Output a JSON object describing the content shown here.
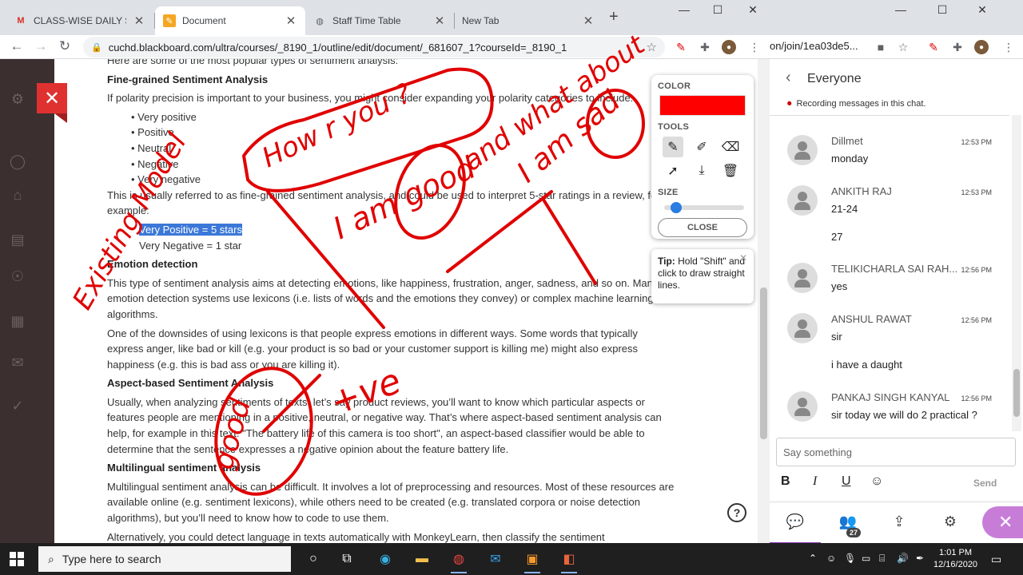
{
  "browser_left": {
    "tabs": [
      {
        "label": "CLASS-WISE DAILY STUD",
        "icon": "gmail-icon",
        "close": "✕"
      },
      {
        "label": "Document",
        "icon": "blackboard-icon",
        "close": "✕"
      },
      {
        "label": "Staff Time Table",
        "icon": "globe-icon",
        "close": "✕"
      },
      {
        "label": "New Tab",
        "icon": "",
        "close": "✕"
      }
    ],
    "new_tab": "+",
    "window_controls": {
      "minimize": "—",
      "maximize": "☐",
      "close": "✕"
    },
    "url": "cuchd.blackboard.com/ultra/courses/_8190_1/outline/edit/document/_681607_1?courseId=_8190_1"
  },
  "document": {
    "intro": "Here are some of the most popular types of sentiment analysis:",
    "sections": {
      "fine_grained": {
        "heading": "Fine-grained Sentiment Analysis",
        "p1": "If polarity precision is important to your business, you might consider expanding your polarity categories to include:",
        "bullets": [
          "Very positive",
          "Positive",
          "Neutral",
          "Negative",
          "Very negative"
        ],
        "p2": "This is usually referred to as fine-grained sentiment analysis, and could be used to interpret 5-star ratings in a review, for example:",
        "ex1": "Very Positive = 5 stars",
        "ex2": "Very Negative = 1 star"
      },
      "emotion": {
        "heading": "Emotion detection",
        "p1": "This type of sentiment analysis aims at detecting emotions, like happiness, frustration, anger, sadness, and so on. Many emotion detection systems use lexicons (i.e. lists of words and the emotions they convey) or complex machine learning algorithms.",
        "p2": "One of the downsides of using lexicons is that people express emotions in different ways. Some words that typically express anger, like bad or kill (e.g. your product is so bad or your customer support is killing me) might also express happiness (e.g. this is bad ass or you are killing it)."
      },
      "aspect": {
        "heading": "Aspect-based Sentiment Analysis",
        "p1": "Usually, when analyzing sentiments of texts, let’s say product reviews, you’ll want to know which particular aspects or features people are mentioning in a positive, neutral, or negative way. That’s where aspect-based sentiment analysis can help, for example in this text: \"The battery life of this camera is too short\", an aspect-based classifier would be able to determine that the sentence expresses a negative opinion about the feature battery life."
      },
      "multilingual": {
        "heading": "Multilingual sentiment analysis",
        "p1": "Multilingual sentiment analysis can be difficult. It involves a lot of preprocessing and resources. Most of these resources are available online (e.g. sentiment lexicons), while others need to be created (e.g. translated corpora or noise detection algorithms), but you’ll need to know how to code to use them.",
        "p2": "Alternatively, you could detect language in texts automatically with MonkeyLearn, then classify the sentiment"
      }
    }
  },
  "drawing_panel": {
    "color_label": "COLOR",
    "current_color": "#ff0000",
    "tools_label": "TOOLS",
    "size_label": "SIZE",
    "size_value": 0.1,
    "close_label": "CLOSE",
    "tip_bold": "Tip:",
    "tip_text": " Hold \"Shift\" and click to draw straight lines."
  },
  "annotations": {
    "color": "#e00000",
    "texts": [
      "How r you ?",
      "I am good",
      "and what about",
      "I am sad",
      "Existing Model",
      "good",
      "+ve"
    ]
  },
  "browser_right": {
    "url": "on/join/1ea03de5...",
    "chat": {
      "title": "Everyone",
      "recording_note": "Recording messages in this chat.",
      "messages": [
        {
          "name": "Dillmet",
          "time": "12:53 PM",
          "lines": [
            "monday"
          ]
        },
        {
          "name": "ANKITH RAJ",
          "time": "12:53 PM",
          "lines": [
            "21-24",
            "27"
          ]
        },
        {
          "name": "TELIKICHARLA SAI RAH...",
          "time": "12:56 PM",
          "lines": [
            "yes"
          ]
        },
        {
          "name": "ANSHUL RAWAT",
          "time": "12:56 PM",
          "lines": [
            "sir",
            "i have a daught"
          ]
        },
        {
          "name": "PANKAJ SINGH KANYAL",
          "time": "12:56 PM",
          "lines": [
            "sir today we will do 2 practical ?"
          ]
        }
      ],
      "input_placeholder": "Say something",
      "format": {
        "bold": "B",
        "italic": "I",
        "underline": "U"
      },
      "send_label": "Send",
      "participants_count": "27"
    }
  },
  "taskbar": {
    "search_placeholder": "Type here to search",
    "time": "1:01 PM",
    "date": "12/16/2020"
  }
}
